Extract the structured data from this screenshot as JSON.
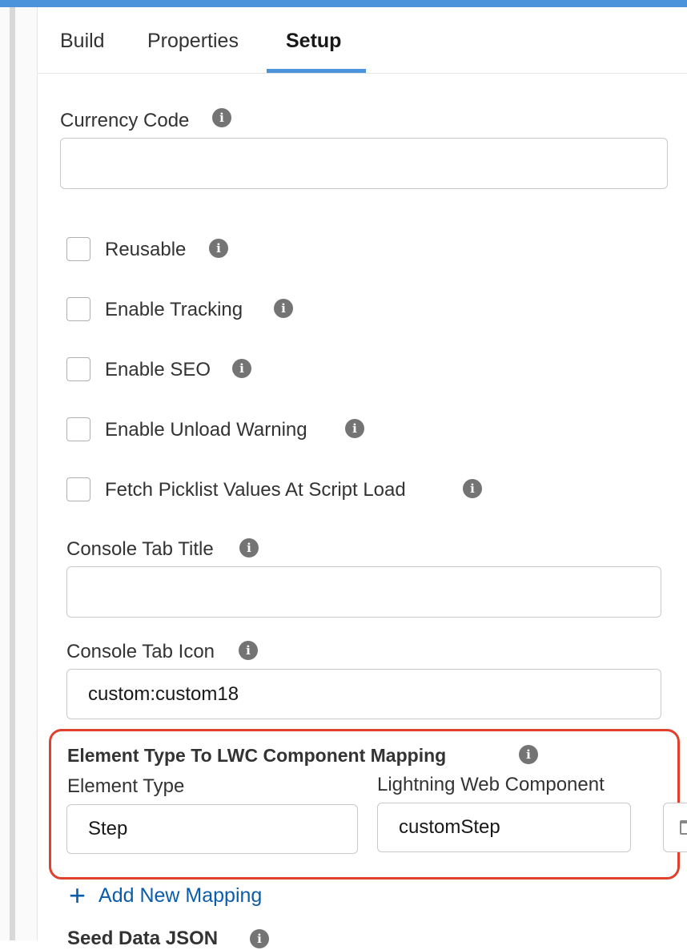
{
  "tabs": [
    {
      "label": "Build"
    },
    {
      "label": "Properties"
    },
    {
      "label": "Setup"
    }
  ],
  "currency": {
    "label": "Currency Code",
    "value": ""
  },
  "checkboxes": [
    {
      "label": "Reusable",
      "checked": false
    },
    {
      "label": "Enable Tracking",
      "checked": false
    },
    {
      "label": "Enable SEO",
      "checked": false
    },
    {
      "label": "Enable Unload Warning",
      "checked": false
    },
    {
      "label": "Fetch Picklist Values At Script Load",
      "checked": false
    }
  ],
  "console_title": {
    "label": "Console Tab Title",
    "value": ""
  },
  "console_icon": {
    "label": "Console Tab Icon",
    "value": "custom:custom18"
  },
  "mapping": {
    "title": "Element Type To LWC Component Mapping",
    "element_type_label": "Element Type",
    "lwc_label": "Lightning Web Component",
    "element_type_value": "Step",
    "lwc_value": "customStep",
    "add_label": "Add New Mapping"
  },
  "next_section": {
    "label": "Seed Data JSON"
  },
  "info_icon": "i",
  "colors": {
    "accent": "#4b94db",
    "highlight": "#e0412c",
    "link": "#0b5cab"
  }
}
